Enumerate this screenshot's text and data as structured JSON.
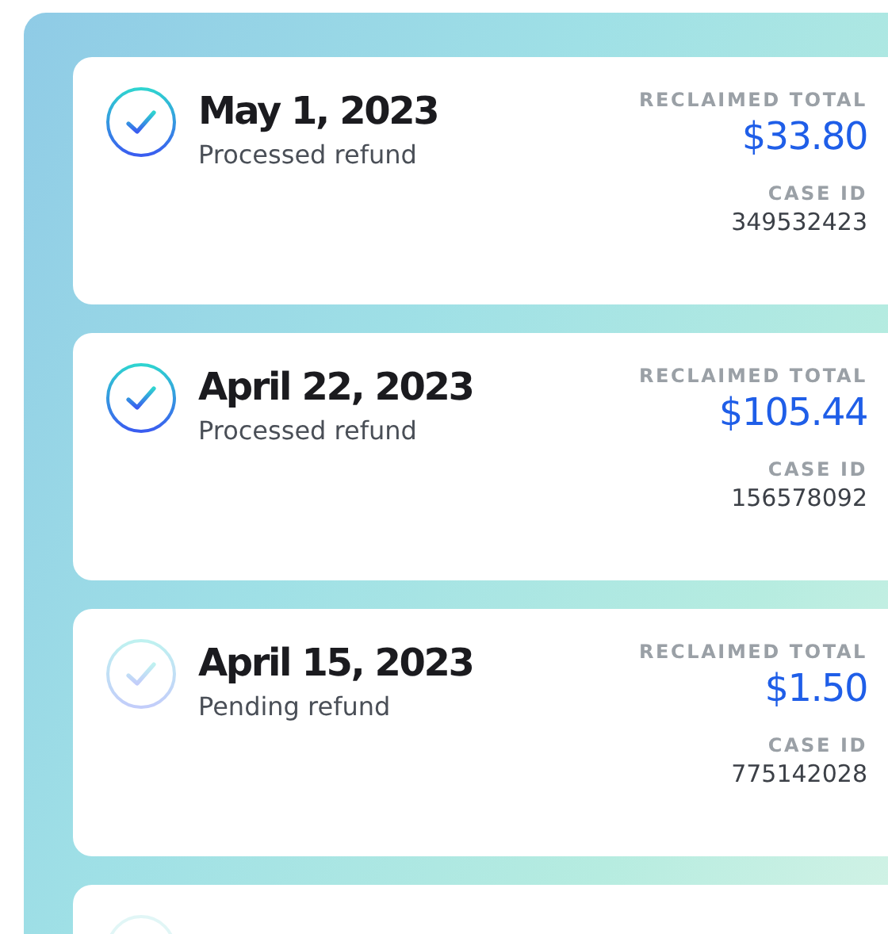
{
  "refunds": [
    {
      "date": "May 1, 2023",
      "status": "Processed refund",
      "completed": true,
      "total_label": "RECLAIMED TOTAL",
      "total": "$33.80",
      "case_label": "CASE ID",
      "case_id": "349532423"
    },
    {
      "date": "April 22, 2023",
      "status": "Processed refund",
      "completed": true,
      "total_label": "RECLAIMED TOTAL",
      "total": "$105.44",
      "case_label": "CASE ID",
      "case_id": "156578092"
    },
    {
      "date": "April 15, 2023",
      "status": "Pending refund",
      "completed": false,
      "total_label": "RECLAIMED TOTAL",
      "total": "$1.50",
      "case_label": "CASE ID",
      "case_id": "775142028"
    }
  ]
}
